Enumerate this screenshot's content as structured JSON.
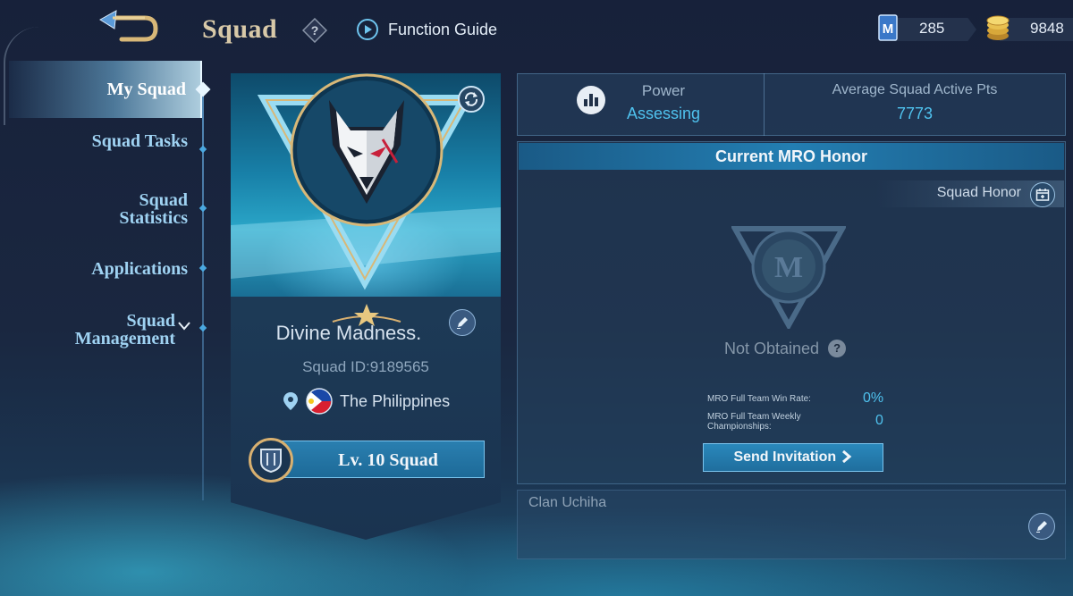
{
  "header": {
    "title": "Squad",
    "function_guide": "Function Guide",
    "currency_tickets": "285",
    "currency_gold": "9848"
  },
  "sidebar": {
    "items": [
      {
        "label": "My Squad",
        "active": true
      },
      {
        "label": "Squad Tasks",
        "active": false
      },
      {
        "label": "Squad Statistics",
        "active": false
      },
      {
        "label": "Applications",
        "active": false
      },
      {
        "label": "Squad Management",
        "active": false
      }
    ]
  },
  "squad_card": {
    "name": "Divine Madness.",
    "id_text": "Squad ID:9189565",
    "country": "The Philippines",
    "level": "Lv. 10 Squad"
  },
  "stats": {
    "power_label": "Power",
    "power_value": "Assessing",
    "avg_label": "Average Squad Active Pts",
    "avg_value": "7773"
  },
  "honor": {
    "header": "Current MRO Honor",
    "squad_honor": "Squad Honor",
    "status": "Not Obtained",
    "win_rate_label": "MRO Full Team Win Rate:",
    "win_rate_value": "0%",
    "weekly_label": "MRO Full Team Weekly Championships:",
    "weekly_value": "0",
    "send_invitation": "Send Invitation"
  },
  "description": {
    "text": "Clan Uchiha"
  },
  "colors": {
    "accent": "#4fc2ee",
    "gold": "#d8c9a8",
    "background": "#17213a"
  },
  "icons": [
    "back-arrow-icon",
    "help-icon",
    "play-icon",
    "ticket-icon",
    "gold-coin-icon",
    "refresh-icon",
    "edit-icon",
    "location-pin-icon",
    "philippines-flag-icon",
    "squad-level-badge-icon",
    "power-chart-icon",
    "squad-honor-icon",
    "mro-emblem-icon",
    "chevron-right-icon",
    "chevron-down-icon"
  ]
}
